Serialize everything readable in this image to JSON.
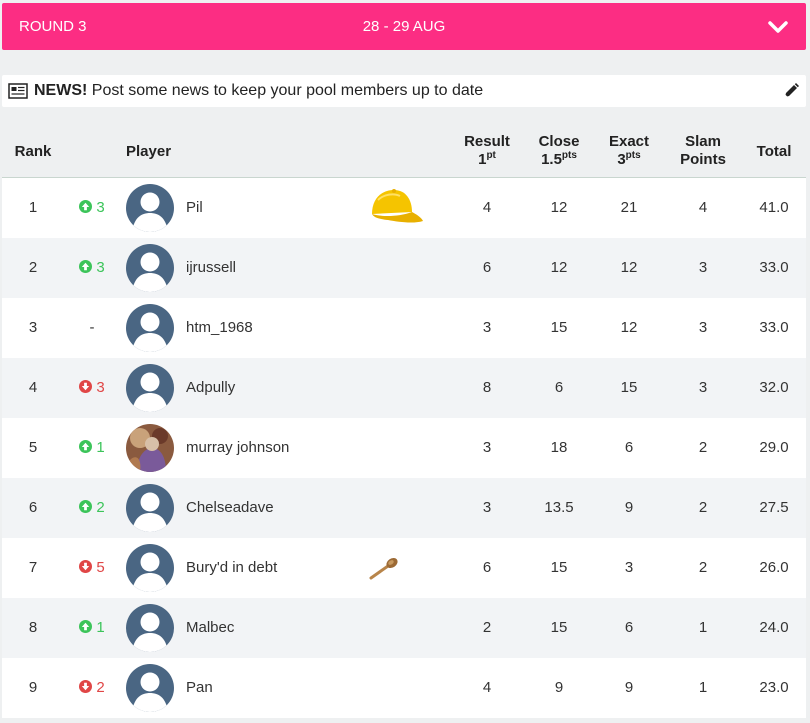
{
  "round": {
    "title": "ROUND 3",
    "dates": "28 - 29 AUG",
    "bar_color": "#fc2d83",
    "toggle_icon": "chevron-down-icon"
  },
  "news": {
    "label": "NEWS!",
    "message": " Post some news to keep your pool members up to date",
    "icon": "newspaper-icon",
    "edit_icon": "pencil-icon"
  },
  "table": {
    "headers": {
      "rank": "Rank",
      "player": "Player",
      "result": "Result",
      "result_pts": "1",
      "result_unit": "pt",
      "close": "Close",
      "close_pts": "1.5",
      "close_unit": "pts",
      "exact": "Exact",
      "exact_pts": "3",
      "exact_unit": "pts",
      "slam": "Slam",
      "slam2": "Points",
      "total": "Total"
    },
    "rows": [
      {
        "rank": "1",
        "dir": "up",
        "move": "3",
        "name": "Pil",
        "avatar": "default",
        "badge": "cap-icon",
        "result": "4",
        "close": "12",
        "exact": "21",
        "slam": "4",
        "total": "41.0"
      },
      {
        "rank": "2",
        "dir": "up",
        "move": "3",
        "name": "ijrussell",
        "avatar": "default",
        "badge": "",
        "result": "6",
        "close": "12",
        "exact": "12",
        "slam": "3",
        "total": "33.0"
      },
      {
        "rank": "3",
        "dir": "none",
        "move": "-",
        "name": "htm_1968",
        "avatar": "default",
        "badge": "",
        "result": "3",
        "close": "15",
        "exact": "12",
        "slam": "3",
        "total": "33.0"
      },
      {
        "rank": "4",
        "dir": "down",
        "move": "3",
        "name": "Adpully",
        "avatar": "default",
        "badge": "",
        "result": "8",
        "close": "6",
        "exact": "15",
        "slam": "3",
        "total": "32.0"
      },
      {
        "rank": "5",
        "dir": "up",
        "move": "1",
        "name": "murray johnson",
        "avatar": "photo",
        "badge": "",
        "result": "3",
        "close": "18",
        "exact": "6",
        "slam": "2",
        "total": "29.0"
      },
      {
        "rank": "6",
        "dir": "up",
        "move": "2",
        "name": "Chelseadave",
        "avatar": "default",
        "badge": "",
        "result": "3",
        "close": "13.5",
        "exact": "9",
        "slam": "2",
        "total": "27.5"
      },
      {
        "rank": "7",
        "dir": "down",
        "move": "5",
        "name": "Bury'd in debt",
        "avatar": "default",
        "badge": "wooden-spoon-icon",
        "result": "6",
        "close": "15",
        "exact": "3",
        "slam": "2",
        "total": "26.0"
      },
      {
        "rank": "8",
        "dir": "up",
        "move": "1",
        "name": "Malbec",
        "avatar": "default",
        "badge": "",
        "result": "2",
        "close": "15",
        "exact": "6",
        "slam": "1",
        "total": "24.0"
      },
      {
        "rank": "9",
        "dir": "down",
        "move": "2",
        "name": "Pan",
        "avatar": "default",
        "badge": "",
        "result": "4",
        "close": "9",
        "exact": "9",
        "slam": "1",
        "total": "23.0"
      }
    ]
  },
  "colors": {
    "up": "#3cc45a",
    "down": "#e04646",
    "avatar": "#4a6683"
  }
}
